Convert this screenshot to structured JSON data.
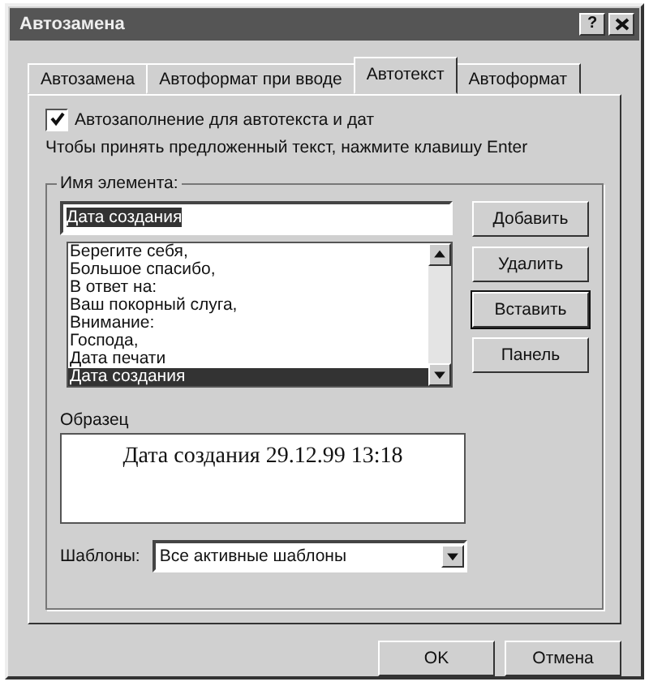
{
  "window": {
    "title": "Автозамена",
    "help_button": "?"
  },
  "tabs": [
    {
      "label": "Автозамена",
      "selected": false
    },
    {
      "label": "Автоформат при вводе",
      "selected": false
    },
    {
      "label": "Автотекст",
      "selected": true
    },
    {
      "label": "Автоформат",
      "selected": false
    }
  ],
  "autocomplete": {
    "label": "Автозаполнение для автотекста и дат",
    "checked": true
  },
  "hint": "Чтобы принять предложенный текст, нажмите клавишу Enter",
  "element_name": {
    "label": "Имя элемента:",
    "value": "Дата создания",
    "items": [
      {
        "label": "Берегите себя,",
        "selected": false
      },
      {
        "label": "Большое спасибо,",
        "selected": false
      },
      {
        "label": "В ответ на:",
        "selected": false
      },
      {
        "label": "Ваш покорный слуга,",
        "selected": false
      },
      {
        "label": "Внимание:",
        "selected": false
      },
      {
        "label": "Господа,",
        "selected": false
      },
      {
        "label": "Дата печати",
        "selected": false
      },
      {
        "label": "Дата создания",
        "selected": true
      }
    ]
  },
  "side_buttons": [
    {
      "label": "Добавить",
      "default": false
    },
    {
      "label": "Удалить",
      "default": false
    },
    {
      "label": "Вставить",
      "default": true
    },
    {
      "label": "Панель",
      "default": false
    }
  ],
  "preview": {
    "label": "Образец",
    "text": "Дата создания 29.12.99 13:18"
  },
  "templates": {
    "label": "Шаблоны:",
    "value": "Все активные шаблоны"
  },
  "footer_buttons": [
    "OK",
    "Отмена"
  ]
}
